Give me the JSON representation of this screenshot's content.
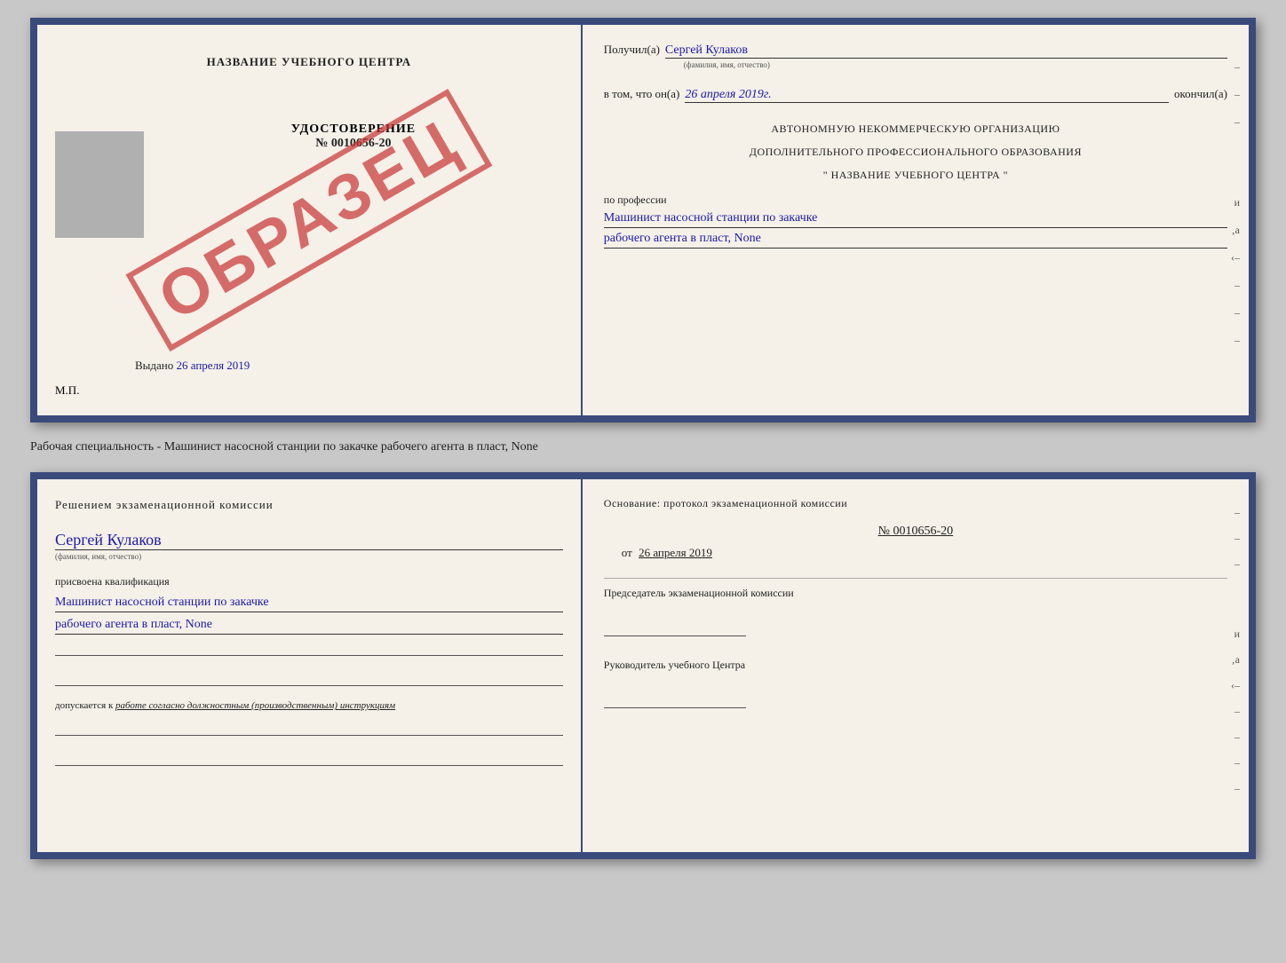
{
  "top_doc": {
    "left": {
      "title": "НАЗВАНИЕ УЧЕБНОГО ЦЕНТРА",
      "stamp": "ОБРАЗЕЦ",
      "udostoverenie_label": "УДОСТОВЕРЕНИЕ",
      "number": "№ 0010656-20",
      "vydano_label": "Выдано",
      "vydano_date": "26 апреля 2019",
      "mp": "М.П."
    },
    "right": {
      "poluchil_label": "Получил(а)",
      "poluchil_value": "Сергей Кулаков",
      "poluchil_hint": "(фамилия, имя, отчество)",
      "vtom_label": "в том, что он(а)",
      "vtom_value": "26 апреля 2019г.",
      "okonchil_label": "окончил(а)",
      "static1": "АВТОНОМНУЮ НЕКОММЕРЧЕСКУЮ ОРГАНИЗАЦИЮ",
      "static2": "ДОПОЛНИТЕЛЬНОГО ПРОФЕССИОНАЛЬНОГО ОБРАЗОВАНИЯ",
      "static3": "\"   НАЗВАНИЕ УЧЕБНОГО ЦЕНТРА   \"",
      "po_professii_label": "по профессии",
      "profession_line1": "Машинист насосной станции по закачке",
      "profession_line2": "рабочего агента в пласт, None"
    }
  },
  "caption": "Рабочая специальность - Машинист насосной станции по закачке рабочего агента в пласт, None",
  "bottom_doc": {
    "left": {
      "komissia_text": "Решением  экзаменационной  комиссии",
      "name_value": "Сергей Кулаков",
      "name_hint": "(фамилия, имя, отчество)",
      "prisvoena_label": "присвоена квалификация",
      "qualification_line1": "Машинист насосной станции по закачке",
      "qualification_line2": "рабочего агента в пласт, None",
      "dopuskaetsya_text": "допускается к",
      "dopuskaetsya_italic": "работе согласно должностным (производственным) инструкциям"
    },
    "right": {
      "osnov_label": "Основание:  протокол  экзаменационной  комиссии",
      "protocol_number": "№  0010656-20",
      "protocol_date_prefix": "от",
      "protocol_date": "26 апреля 2019",
      "predsedatel_label": "Председатель экзаменационной комиссии",
      "rukovoditel_label": "Руководитель учебного Центра"
    }
  }
}
